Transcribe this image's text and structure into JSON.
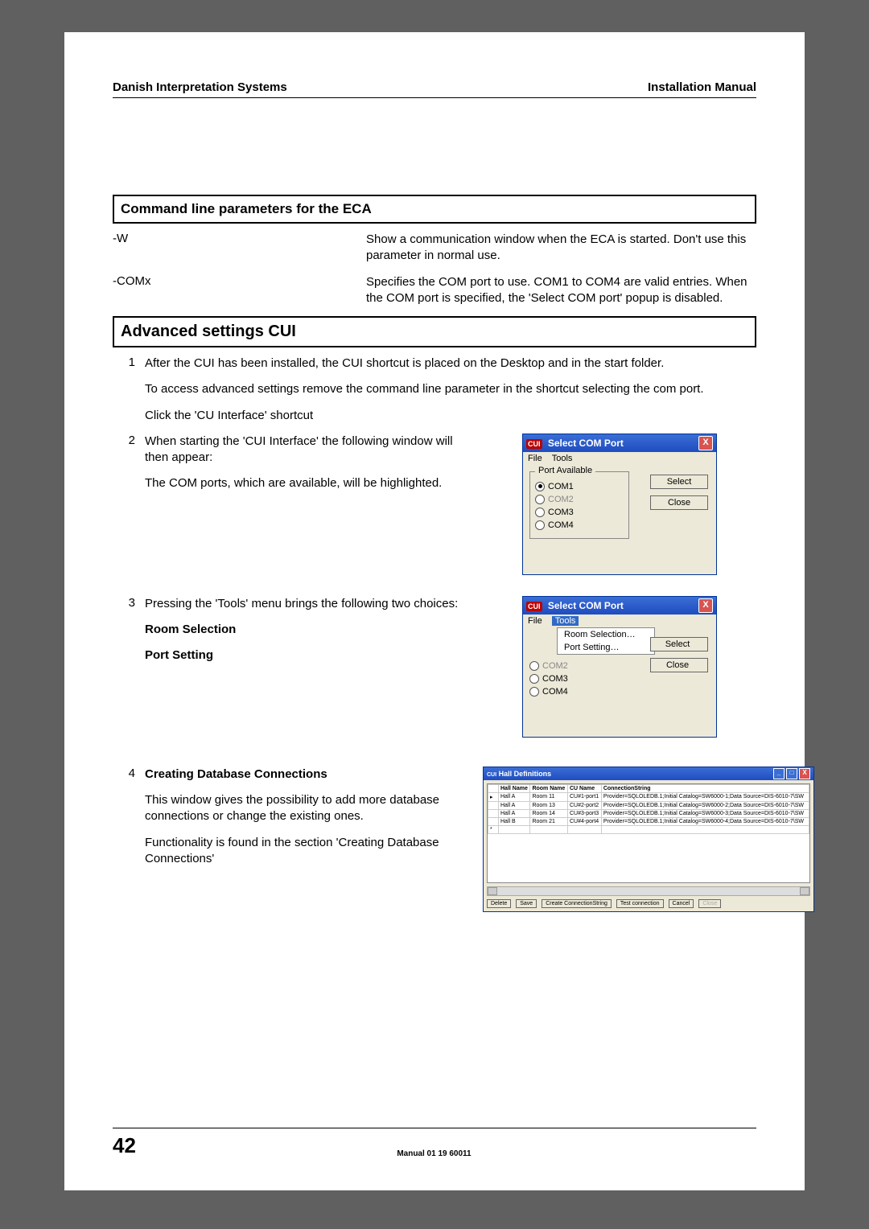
{
  "header": {
    "left": "Danish Interpretation Systems",
    "right": "Installation Manual"
  },
  "section1": {
    "title": "Command line parameters for the ECA",
    "rows": [
      {
        "key": "-W",
        "desc": "Show a communication window when the ECA is started. Don't use this parameter in normal use."
      },
      {
        "key": "-COMx",
        "desc": "Specifies the COM port to use. COM1 to COM4 are valid entries. When the COM port is specified, the 'Select COM port' popup is disabled."
      }
    ]
  },
  "section2": {
    "title": "Advanced settings CUI"
  },
  "steps": {
    "s1": {
      "num": "1",
      "p1": "After the CUI has been installed, the CUI shortcut is placed on the Desktop and in the start folder.",
      "p2": "To access advanced settings remove the command line parameter in the shortcut selecting the com port.",
      "p3": "Click the 'CU Interface' shortcut"
    },
    "s2": {
      "num": "2",
      "p1": "When starting the 'CUI Interface' the following window will then appear:",
      "p2": "The COM ports, which are available, will be highlighted."
    },
    "s3": {
      "num": "3",
      "p1": "Pressing the 'Tools' menu brings the following two choices:",
      "b1": "Room Selection",
      "b2": "Port Setting"
    },
    "s4": {
      "num": "4",
      "h": "Creating Database Connections",
      "p1": "This window gives the possibility to add more database connections or change the existing ones.",
      "p2": "Functionality is found in the section 'Creating Database Connections'"
    }
  },
  "dialog": {
    "cui_badge": "CUI",
    "title": "Select COM Port",
    "menu_file": "File",
    "menu_tools": "Tools",
    "groupbox": "Port Available",
    "com1": "COM1",
    "com2": "COM2",
    "com3": "COM3",
    "com4": "COM4",
    "btn_select": "Select",
    "btn_close": "Close",
    "btn_select_clip": "Select",
    "btn_close_clip": "Close",
    "menu_room": "Room Selection…",
    "menu_port": "Port Setting…",
    "close_x": "X"
  },
  "halldef": {
    "title": "Hall Definitions",
    "min": "_",
    "max": "□",
    "close": "X",
    "headers": {
      "c_mark": "",
      "c_hall": "Hall Name",
      "c_room": "Room Name",
      "c_cu": "CU Name",
      "c_conn": "ConnectionString"
    },
    "rows": [
      {
        "mark": "▸",
        "hall": "Hall A",
        "room": "Room 11",
        "cu": "CU#1-port1",
        "conn": "Provider=SQLOLEDB.1;Initial Catalog=SW6000-1;Data Source=DIS-6010-7\\SW"
      },
      {
        "mark": "",
        "hall": "Hall A",
        "room": "Room 13",
        "cu": "CU#2-port2",
        "conn": "Provider=SQLOLEDB.1;Initial Catalog=SW6000-2;Data Source=DIS-6010-7\\SW"
      },
      {
        "mark": "",
        "hall": "Hall A",
        "room": "Room 14",
        "cu": "CU#3-port3",
        "conn": "Provider=SQLOLEDB.1;Initial Catalog=SW6000-3;Data Source=DIS-6010-7\\SW"
      },
      {
        "mark": "",
        "hall": "Hall B",
        "room": "Room 21",
        "cu": "CU#4-port4",
        "conn": "Provider=SQLOLEDB.1;Initial Catalog=SW6000-4;Data Source=DIS-6010-7\\SW"
      },
      {
        "mark": "*",
        "hall": "",
        "room": "",
        "cu": "",
        "conn": ""
      }
    ],
    "buttons": {
      "delete": "Delete",
      "save": "Save",
      "create": "Create ConnectionString",
      "test": "Test connection",
      "cancel": "Cancel",
      "close": "Close"
    }
  },
  "footer": {
    "page": "42",
    "manual": "Manual 01 19 60011"
  }
}
